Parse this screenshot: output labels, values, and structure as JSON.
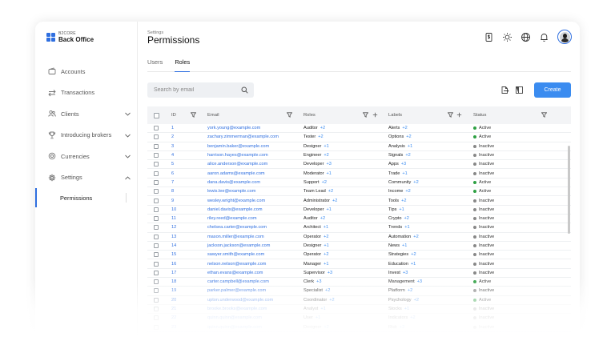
{
  "brand": {
    "top": "B2CORE",
    "bottom": "Back Office"
  },
  "nav": {
    "items": [
      {
        "label": "Accounts",
        "icon": "wallet-icon"
      },
      {
        "label": "Transactions",
        "icon": "transfer-arrows-icon"
      },
      {
        "label": "Clients",
        "icon": "users-icon"
      },
      {
        "label": "Introducing brokers",
        "icon": "trophy-icon"
      },
      {
        "label": "Currencies",
        "icon": "coin-icon"
      },
      {
        "label": "Settings",
        "icon": "gear-icon"
      }
    ],
    "sub_label": "Permissions"
  },
  "header": {
    "breadcrumb": "Settings",
    "title": "Permissions"
  },
  "tabs": [
    {
      "label": "Users"
    },
    {
      "label": "Roles",
      "active": true
    }
  ],
  "search": {
    "placeholder": "Search by email"
  },
  "create_label": "Create",
  "table": {
    "headers": {
      "id": "ID",
      "email": "Email",
      "roles": "Roles",
      "labels": "Labels",
      "status": "Status"
    },
    "rows": [
      {
        "id": "1",
        "email": "york.young@example.com",
        "role": "Auditor",
        "role_more": "+2",
        "label": "Alerts",
        "label_more": "+2",
        "status": "Active"
      },
      {
        "id": "2",
        "email": "zachary.zimmerman@example.com",
        "role": "Tester",
        "role_more": "+2",
        "label": "Options",
        "label_more": "+2",
        "status": "Active"
      },
      {
        "id": "3",
        "email": "benjamin.baker@example.com",
        "role": "Designer",
        "role_more": "+1",
        "label": "Analysis",
        "label_more": "+1",
        "status": "Inactive"
      },
      {
        "id": "4",
        "email": "harrison.hayes@example.com",
        "role": "Engineer",
        "role_more": "+2",
        "label": "Signals",
        "label_more": "+2",
        "status": "Inactive"
      },
      {
        "id": "5",
        "email": "alice.anderson@example.com",
        "role": "Developer",
        "role_more": "+3",
        "label": "Apps",
        "label_more": "+3",
        "status": "Inactive"
      },
      {
        "id": "6",
        "email": "aaron.adams@example.com",
        "role": "Moderator",
        "role_more": "+1",
        "label": "Trade",
        "label_more": "+1",
        "status": "Inactive"
      },
      {
        "id": "7",
        "email": "dana.davis@example.com",
        "role": "Support",
        "role_more": "+2",
        "label": "Community",
        "label_more": "+2",
        "status": "Active"
      },
      {
        "id": "8",
        "email": "lewis.lee@example.com",
        "role": "Team Lead",
        "role_more": "+2",
        "label": "Income",
        "label_more": "+2",
        "status": "Active"
      },
      {
        "id": "9",
        "email": "wesley.wright@example.com",
        "role": "Administrator",
        "role_more": "+2",
        "label": "Tools",
        "label_more": "+2",
        "status": "Inactive"
      },
      {
        "id": "10",
        "email": "daniel.davis@example.com",
        "role": "Developer",
        "role_more": "+1",
        "label": "Tips",
        "label_more": "+1",
        "status": "Inactive"
      },
      {
        "id": "11",
        "email": "riley.reed@example.com",
        "role": "Auditor",
        "role_more": "+2",
        "label": "Crypto",
        "label_more": "+2",
        "status": "Inactive"
      },
      {
        "id": "12",
        "email": "chelsea.carter@example.com",
        "role": "Architect",
        "role_more": "+1",
        "label": "Trends",
        "label_more": "+1",
        "status": "Inactive"
      },
      {
        "id": "13",
        "email": "mason.miller@example.com",
        "role": "Operator",
        "role_more": "+2",
        "label": "Automation",
        "label_more": "+2",
        "status": "Inactive"
      },
      {
        "id": "14",
        "email": "jackson.jackson@example.com",
        "role": "Designer",
        "role_more": "+1",
        "label": "News",
        "label_more": "+1",
        "status": "Inactive"
      },
      {
        "id": "15",
        "email": "sawyer.smith@example.com",
        "role": "Operator",
        "role_more": "+2",
        "label": "Strategies",
        "label_more": "+2",
        "status": "Inactive"
      },
      {
        "id": "16",
        "email": "nelson.nelson@example.com",
        "role": "Manager",
        "role_more": "+1",
        "label": "Education",
        "label_more": "+1",
        "status": "Inactive"
      },
      {
        "id": "17",
        "email": "ethan.evans@example.com",
        "role": "Supervisor",
        "role_more": "+3",
        "label": "Invest",
        "label_more": "+3",
        "status": "Inactive"
      },
      {
        "id": "18",
        "email": "carter.campbell@example.com",
        "role": "Clerk",
        "role_more": "+3",
        "label": "Management",
        "label_more": "+3",
        "status": "Active"
      },
      {
        "id": "19",
        "email": "parker.palmer@example.com",
        "role": "Specialist",
        "role_more": "+2",
        "label": "Platform",
        "label_more": "+2",
        "status": "Inactive"
      },
      {
        "id": "20",
        "email": "upton.underwood@example.com",
        "role": "Coordinator",
        "role_more": "+2",
        "label": "Psychology",
        "label_more": "+2",
        "status": "Active"
      },
      {
        "id": "21",
        "email": "brooke.brooks@example.com",
        "role": "Analyst",
        "role_more": "+1",
        "label": "Stocks",
        "label_more": "+1",
        "status": "Inactive"
      },
      {
        "id": "22",
        "email": "quinn.quinn@example.com",
        "role": "User",
        "role_more": "+1",
        "label": "Indicators",
        "label_more": "+2",
        "status": "Inactive"
      },
      {
        "id": "23",
        "email": "quinn.quinn@example.com",
        "role": "Designer",
        "role_more": "+2",
        "label": "Risk",
        "label_more": "+2",
        "status": "Inactive"
      }
    ]
  },
  "colors": {
    "accent": "#3b8cf0",
    "active": "#2ea043",
    "inactive": "#888888"
  }
}
